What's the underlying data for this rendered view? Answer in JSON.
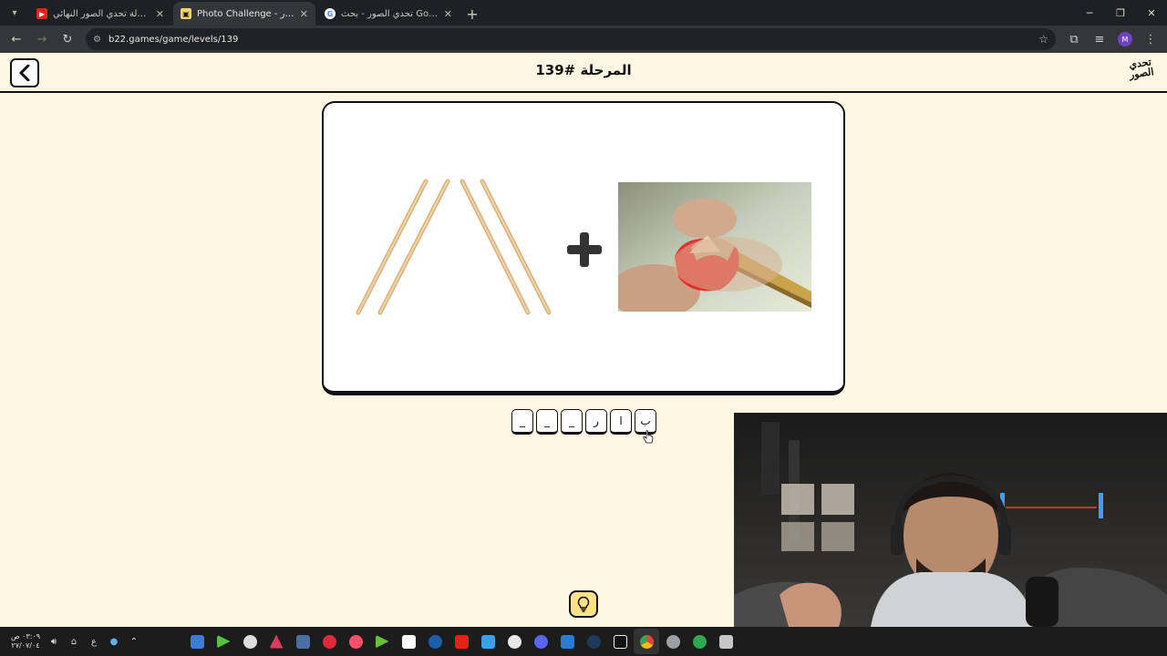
{
  "browser": {
    "tabs": [
      {
        "title": "بطولة تحدي الصور النهائي ⭐ 🌙",
        "active": false
      },
      {
        "title": "Photo Challenge - تحدي الصور",
        "active": true
      },
      {
        "title": "تحدي الصور - بحث Google",
        "active": false
      }
    ],
    "url": "b22.games/game/levels/139"
  },
  "game": {
    "level_title": "المرحلة #139",
    "logo_text": "تحدي الصور",
    "answer_slots": [
      "ب",
      "ا",
      "ر",
      "_",
      "_",
      "_"
    ]
  },
  "taskbar": {
    "time": "٠٣:٠٩ ص",
    "date": "٢٧/٠٧/٠٤",
    "lang": "ع"
  },
  "colors": {
    "page_bg": "#fdf6e3",
    "hint_bg": "#fde28a",
    "ink": "#111111"
  }
}
